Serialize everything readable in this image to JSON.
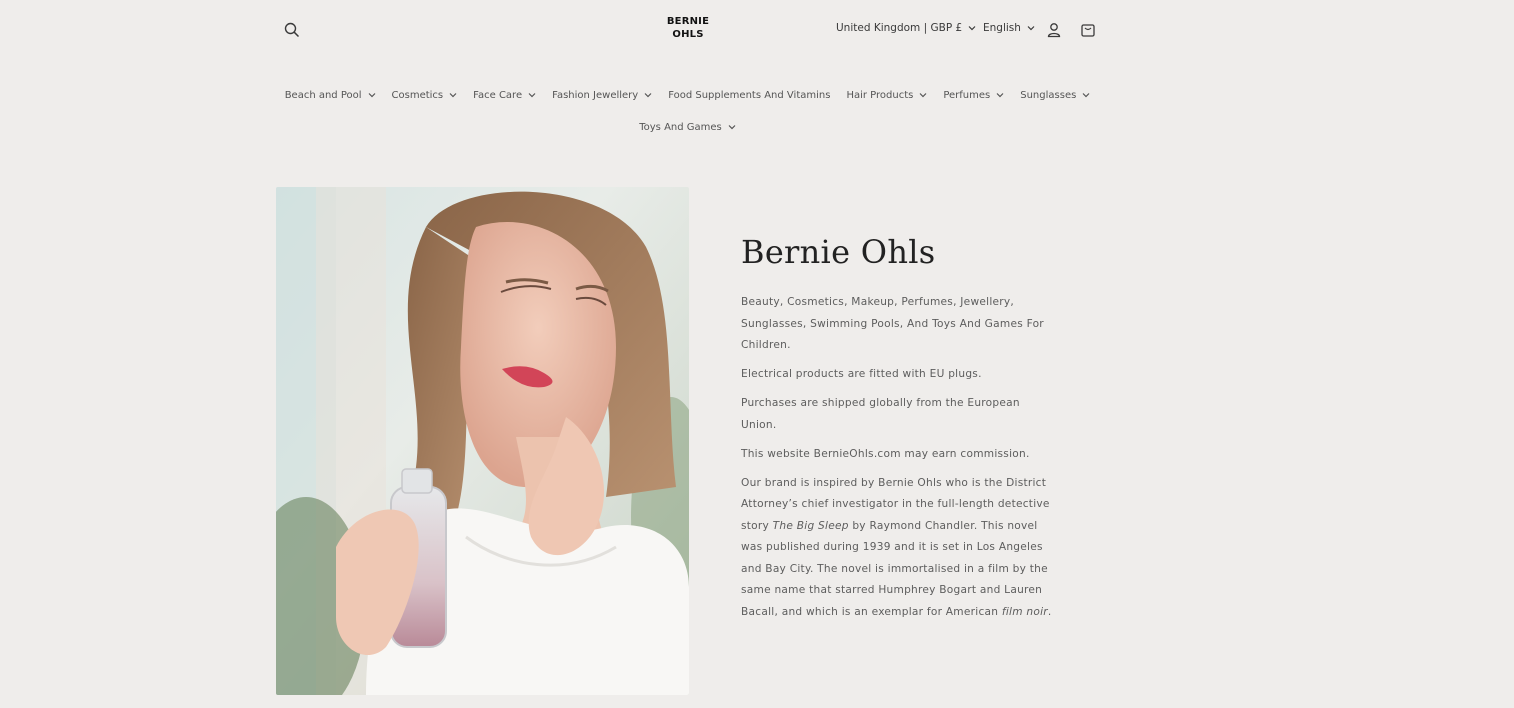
{
  "header": {
    "logo_line1": "BERNIE",
    "logo_line2": "OHLS",
    "country_label": "United Kingdom | GBP £",
    "language_label": "English"
  },
  "nav": {
    "items": [
      {
        "label": "Beach and Pool",
        "has_dropdown": true
      },
      {
        "label": "Cosmetics",
        "has_dropdown": true
      },
      {
        "label": "Face Care",
        "has_dropdown": true
      },
      {
        "label": "Fashion Jewellery",
        "has_dropdown": true
      },
      {
        "label": "Food Supplements And Vitamins",
        "has_dropdown": false
      },
      {
        "label": "Hair Products",
        "has_dropdown": true
      },
      {
        "label": "Perfumes",
        "has_dropdown": true
      },
      {
        "label": "Sunglasses",
        "has_dropdown": true
      },
      {
        "label": "Toys And Games",
        "has_dropdown": true
      }
    ]
  },
  "main": {
    "title": "Bernie Ohls",
    "p1": "Beauty, Cosmetics, Makeup, Perfumes, Jewellery, Sunglasses, Swimming Pools, And Toys And Games For Children.",
    "p2": "Electrical products are fitted with EU plugs.",
    "p3": "Purchases are shipped globally from the European Union.",
    "p4": "This website BernieOhls.com may earn commission.",
    "p5_a": "Our brand is inspired by Bernie Ohls who is the District Attorney’s chief investigator in the full-length detective story ",
    "p5_italic1": "The Big Sleep",
    "p5_b": " by Raymond Chandler. This novel was published during 1939 and it is set in Los Angeles and Bay City. The novel is immortalised in a film by the same name that starred Humphrey Bogart and Lauren Bacall, and which is an exemplar for American ",
    "p5_italic2": "film noir",
    "p5_c": "."
  },
  "colors": {
    "background": "#efedeb",
    "text": "#3a3a3a",
    "muted_text": "#5d5d5d"
  },
  "icons": {
    "search": "search-icon",
    "account": "account-icon",
    "cart": "cart-icon",
    "chevron": "chevron-down-icon"
  }
}
